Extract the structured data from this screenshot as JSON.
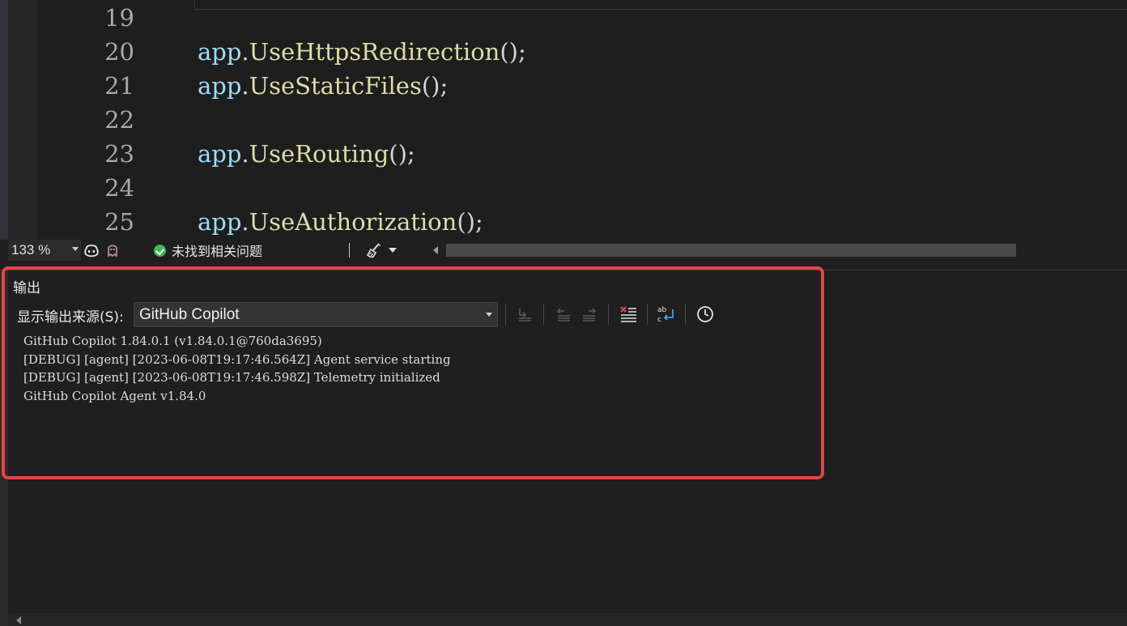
{
  "editor": {
    "lines": [
      {
        "num": "19",
        "tokens": []
      },
      {
        "num": "20",
        "tokens": [
          {
            "cls": "tok-obj",
            "text": "app"
          },
          {
            "cls": "tok-punc",
            "text": "."
          },
          {
            "cls": "tok-method",
            "text": "UseHttpsRedirection"
          },
          {
            "cls": "tok-punc",
            "text": "();"
          }
        ]
      },
      {
        "num": "21",
        "tokens": [
          {
            "cls": "tok-obj",
            "text": "app"
          },
          {
            "cls": "tok-punc",
            "text": "."
          },
          {
            "cls": "tok-method",
            "text": "UseStaticFiles"
          },
          {
            "cls": "tok-punc",
            "text": "();"
          }
        ]
      },
      {
        "num": "22",
        "tokens": []
      },
      {
        "num": "23",
        "tokens": [
          {
            "cls": "tok-obj",
            "text": "app"
          },
          {
            "cls": "tok-punc",
            "text": "."
          },
          {
            "cls": "tok-method",
            "text": "UseRouting"
          },
          {
            "cls": "tok-punc",
            "text": "();"
          }
        ]
      },
      {
        "num": "24",
        "tokens": []
      },
      {
        "num": "25",
        "tokens": [
          {
            "cls": "tok-obj",
            "text": "app"
          },
          {
            "cls": "tok-punc",
            "text": "."
          },
          {
            "cls": "tok-method",
            "text": "UseAuthorization"
          },
          {
            "cls": "tok-punc",
            "text": "();"
          }
        ]
      }
    ]
  },
  "statusbar": {
    "zoom": "133 %",
    "issues_text": "未找到相关问题",
    "icons": [
      "copilot-icon",
      "ghost-icon",
      "no-issues-icon",
      "cleanup-brush-icon"
    ]
  },
  "output": {
    "title": "输出",
    "source_label": "显示输出来源(S):",
    "source_value": "GitHub Copilot",
    "toolbar_icons": [
      "goto-prev-message-icon",
      "goto-prev-icon",
      "goto-next-icon",
      "clear-all-icon",
      "toggle-word-wrap-icon",
      "timestamp-icon"
    ],
    "log_lines": [
      "GitHub Copilot 1.84.0.1 (v1.84.0.1@760da3695)",
      "[DEBUG] [agent] [2023-06-08T19:17:46.564Z] Agent service starting",
      "[DEBUG] [agent] [2023-06-08T19:17:46.598Z] Telemetry initialized",
      "GitHub Copilot Agent v1.84.0"
    ]
  },
  "colors": {
    "highlight_border": "#e84343",
    "code_object": "#9cdcfe",
    "code_method": "#dcdcaa",
    "code_punctuation": "#d4d4d4",
    "line_number": "#a8a8a8",
    "ok_check": "#3fb950"
  }
}
